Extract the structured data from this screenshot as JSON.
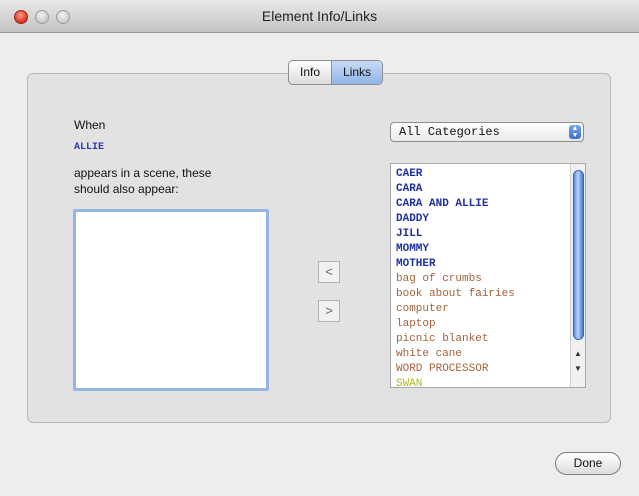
{
  "window": {
    "title": "Element Info/Links"
  },
  "tabs": [
    {
      "label": "Info",
      "active": false
    },
    {
      "label": "Links",
      "active": true
    }
  ],
  "left": {
    "when_label": "When",
    "element_name": "ALLIE",
    "appears_line1": "appears in a scene, these",
    "appears_line2": "should also appear:",
    "linked_items": []
  },
  "buttons": {
    "add_arrow": "<",
    "remove_arrow": ">",
    "done_label": "Done"
  },
  "category_select": {
    "value": "All Categories",
    "arrow_glyphs": "▲▼"
  },
  "element_list": {
    "items": [
      {
        "label": "CAER",
        "kind": "character"
      },
      {
        "label": "CARA",
        "kind": "character"
      },
      {
        "label": "CARA AND ALLIE",
        "kind": "character"
      },
      {
        "label": "DADDY",
        "kind": "character"
      },
      {
        "label": "JILL",
        "kind": "character"
      },
      {
        "label": "MOMMY",
        "kind": "character"
      },
      {
        "label": "MOTHER",
        "kind": "character"
      },
      {
        "label": "bag of crumbs",
        "kind": "prop"
      },
      {
        "label": "book about fairies",
        "kind": "prop"
      },
      {
        "label": "computer",
        "kind": "prop"
      },
      {
        "label": "laptop",
        "kind": "prop"
      },
      {
        "label": "picnic blanket",
        "kind": "prop"
      },
      {
        "label": "white cane",
        "kind": "prop"
      },
      {
        "label": "WORD PROCESSOR",
        "kind": "prop"
      },
      {
        "label": "SWAN",
        "kind": "special"
      }
    ],
    "scroll_up_glyph": "▲",
    "scroll_down_glyph": "▼"
  },
  "colors": {
    "character": "#1f2fa2",
    "prop": "#a4623a",
    "special": "#b2b820",
    "focus_ring": "#93b6e3",
    "accent": "#3a6fcf"
  }
}
